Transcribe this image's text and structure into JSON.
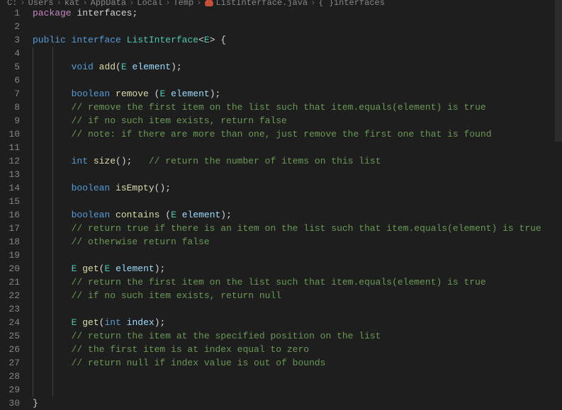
{
  "breadcrumb": {
    "parts": [
      "C:",
      "Users",
      "kat",
      "AppData",
      "Local",
      "Temp"
    ],
    "file": "ListInterface.java",
    "symbol": "interfaces"
  },
  "code": {
    "lines": [
      {
        "n": 1,
        "indent": 0,
        "tokens": [
          {
            "t": "package",
            "c": "k-purple"
          },
          {
            "t": " ",
            "c": "k-text"
          },
          {
            "t": "interfaces",
            "c": "k-text"
          },
          {
            "t": ";",
            "c": "k-punct"
          }
        ]
      },
      {
        "n": 2,
        "indent": 0,
        "tokens": []
      },
      {
        "n": 3,
        "indent": 0,
        "tokens": [
          {
            "t": "public",
            "c": "k-blue"
          },
          {
            "t": " ",
            "c": "k-text"
          },
          {
            "t": "interface",
            "c": "k-blue"
          },
          {
            "t": " ",
            "c": "k-text"
          },
          {
            "t": "ListInterface",
            "c": "k-type"
          },
          {
            "t": "<",
            "c": "k-punct"
          },
          {
            "t": "E",
            "c": "k-type"
          },
          {
            "t": "> {",
            "c": "k-punct"
          }
        ]
      },
      {
        "n": 4,
        "indent": 0,
        "tokens": []
      },
      {
        "n": 5,
        "indent": 2,
        "tokens": [
          {
            "t": "void",
            "c": "k-blue"
          },
          {
            "t": " ",
            "c": "k-text"
          },
          {
            "t": "add",
            "c": "k-method"
          },
          {
            "t": "(",
            "c": "k-punct"
          },
          {
            "t": "E",
            "c": "k-type"
          },
          {
            "t": " ",
            "c": "k-text"
          },
          {
            "t": "element",
            "c": "k-var"
          },
          {
            "t": ");",
            "c": "k-punct"
          }
        ]
      },
      {
        "n": 6,
        "indent": 0,
        "tokens": []
      },
      {
        "n": 7,
        "indent": 2,
        "tokens": [
          {
            "t": "boolean",
            "c": "k-blue"
          },
          {
            "t": " ",
            "c": "k-text"
          },
          {
            "t": "remove",
            "c": "k-method"
          },
          {
            "t": " (",
            "c": "k-punct"
          },
          {
            "t": "E",
            "c": "k-type"
          },
          {
            "t": " ",
            "c": "k-text"
          },
          {
            "t": "element",
            "c": "k-var"
          },
          {
            "t": ");",
            "c": "k-punct"
          }
        ]
      },
      {
        "n": 8,
        "indent": 2,
        "tokens": [
          {
            "t": "// remove the first item on the list such that item.equals(element) is true",
            "c": "k-comment"
          }
        ]
      },
      {
        "n": 9,
        "indent": 2,
        "tokens": [
          {
            "t": "// if no such item exists, return false",
            "c": "k-comment"
          }
        ]
      },
      {
        "n": 10,
        "indent": 2,
        "tokens": [
          {
            "t": "// note: if there are more than one, just remove the first one that is found",
            "c": "k-comment"
          }
        ]
      },
      {
        "n": 11,
        "indent": 0,
        "tokens": []
      },
      {
        "n": 12,
        "indent": 2,
        "tokens": [
          {
            "t": "int",
            "c": "k-blue"
          },
          {
            "t": " ",
            "c": "k-text"
          },
          {
            "t": "size",
            "c": "k-method"
          },
          {
            "t": "();   ",
            "c": "k-punct"
          },
          {
            "t": "// return the number of items on this list",
            "c": "k-comment"
          }
        ]
      },
      {
        "n": 13,
        "indent": 0,
        "tokens": []
      },
      {
        "n": 14,
        "indent": 2,
        "tokens": [
          {
            "t": "boolean",
            "c": "k-blue"
          },
          {
            "t": " ",
            "c": "k-text"
          },
          {
            "t": "isEmpty",
            "c": "k-method"
          },
          {
            "t": "();",
            "c": "k-punct"
          }
        ]
      },
      {
        "n": 15,
        "indent": 0,
        "tokens": []
      },
      {
        "n": 16,
        "indent": 2,
        "tokens": [
          {
            "t": "boolean",
            "c": "k-blue"
          },
          {
            "t": " ",
            "c": "k-text"
          },
          {
            "t": "contains",
            "c": "k-method"
          },
          {
            "t": " (",
            "c": "k-punct"
          },
          {
            "t": "E",
            "c": "k-type"
          },
          {
            "t": " ",
            "c": "k-text"
          },
          {
            "t": "element",
            "c": "k-var"
          },
          {
            "t": ");",
            "c": "k-punct"
          }
        ]
      },
      {
        "n": 17,
        "indent": 2,
        "tokens": [
          {
            "t": "// return true if there is an item on the list such that item.equals(element) is true",
            "c": "k-comment"
          }
        ]
      },
      {
        "n": 18,
        "indent": 2,
        "tokens": [
          {
            "t": "// otherwise return false",
            "c": "k-comment"
          }
        ]
      },
      {
        "n": 19,
        "indent": 0,
        "tokens": []
      },
      {
        "n": 20,
        "indent": 2,
        "tokens": [
          {
            "t": "E",
            "c": "k-type"
          },
          {
            "t": " ",
            "c": "k-text"
          },
          {
            "t": "get",
            "c": "k-method"
          },
          {
            "t": "(",
            "c": "k-punct"
          },
          {
            "t": "E",
            "c": "k-type"
          },
          {
            "t": " ",
            "c": "k-text"
          },
          {
            "t": "element",
            "c": "k-var"
          },
          {
            "t": ");",
            "c": "k-punct"
          }
        ]
      },
      {
        "n": 21,
        "indent": 2,
        "tokens": [
          {
            "t": "// return the first item on the list such that item.equals(element) is true",
            "c": "k-comment"
          }
        ]
      },
      {
        "n": 22,
        "indent": 2,
        "tokens": [
          {
            "t": "// if no such item exists, return null",
            "c": "k-comment"
          }
        ]
      },
      {
        "n": 23,
        "indent": 0,
        "tokens": []
      },
      {
        "n": 24,
        "indent": 2,
        "tokens": [
          {
            "t": "E",
            "c": "k-type"
          },
          {
            "t": " ",
            "c": "k-text"
          },
          {
            "t": "get",
            "c": "k-method"
          },
          {
            "t": "(",
            "c": "k-punct"
          },
          {
            "t": "int",
            "c": "k-blue"
          },
          {
            "t": " ",
            "c": "k-text"
          },
          {
            "t": "index",
            "c": "k-var"
          },
          {
            "t": ");",
            "c": "k-punct"
          }
        ]
      },
      {
        "n": 25,
        "indent": 2,
        "tokens": [
          {
            "t": "// return the item at the specified position on the list",
            "c": "k-comment"
          }
        ]
      },
      {
        "n": 26,
        "indent": 2,
        "tokens": [
          {
            "t": "// the first item is at index equal to zero",
            "c": "k-comment"
          }
        ]
      },
      {
        "n": 27,
        "indent": 2,
        "tokens": [
          {
            "t": "// return null if index value is out of bounds",
            "c": "k-comment"
          }
        ]
      },
      {
        "n": 28,
        "indent": 0,
        "tokens": []
      },
      {
        "n": 29,
        "indent": 0,
        "tokens": []
      },
      {
        "n": 30,
        "indent": 0,
        "tokens": [
          {
            "t": "}",
            "c": "k-punct"
          }
        ]
      }
    ]
  }
}
